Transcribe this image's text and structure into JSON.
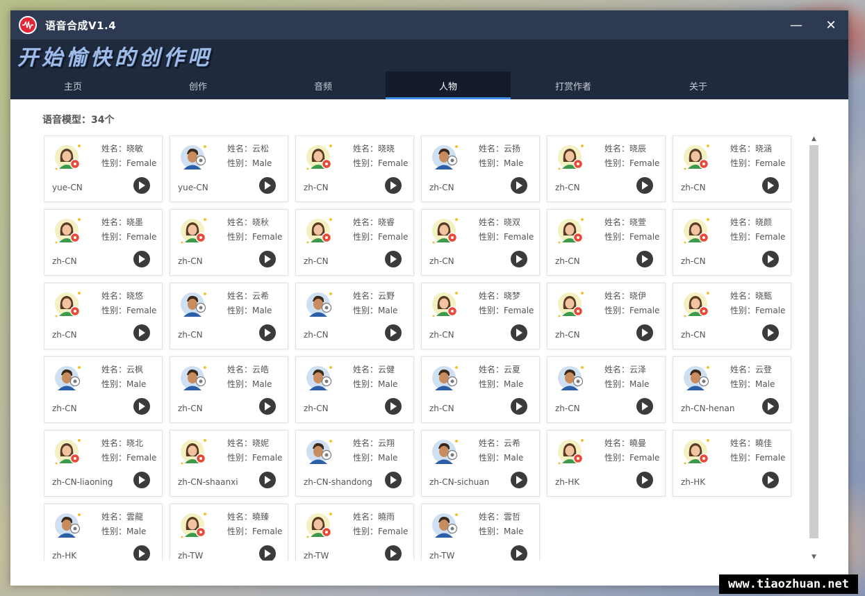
{
  "app": {
    "title": "语音合成V1.4",
    "banner": "开始愉快的创作吧"
  },
  "window_controls": {
    "minimize": "—",
    "close": "✕"
  },
  "tabs": [
    {
      "label": "主页"
    },
    {
      "label": "创作"
    },
    {
      "label": "音频"
    },
    {
      "label": "人物",
      "active": true
    },
    {
      "label": "打赏作者"
    },
    {
      "label": "关于"
    }
  ],
  "labels": {
    "name_prefix": "姓名：",
    "gender_prefix": "性别："
  },
  "model_count_text": "语音模型：34个",
  "voices": [
    {
      "name": "晓敏",
      "gender": "Female",
      "locale": "yue-CN"
    },
    {
      "name": "云松",
      "gender": "Male",
      "locale": "yue-CN"
    },
    {
      "name": "晓晓",
      "gender": "Female",
      "locale": "zh-CN"
    },
    {
      "name": "云扬",
      "gender": "Male",
      "locale": "zh-CN"
    },
    {
      "name": "晓辰",
      "gender": "Female",
      "locale": "zh-CN"
    },
    {
      "name": "晓涵",
      "gender": "Female",
      "locale": "zh-CN"
    },
    {
      "name": "晓墨",
      "gender": "Female",
      "locale": "zh-CN"
    },
    {
      "name": "晓秋",
      "gender": "Female",
      "locale": "zh-CN"
    },
    {
      "name": "晓睿",
      "gender": "Female",
      "locale": "zh-CN"
    },
    {
      "name": "晓双",
      "gender": "Female",
      "locale": "zh-CN"
    },
    {
      "name": "晓萱",
      "gender": "Female",
      "locale": "zh-CN"
    },
    {
      "name": "晓颜",
      "gender": "Female",
      "locale": "zh-CN"
    },
    {
      "name": "晓悠",
      "gender": "Female",
      "locale": "zh-CN"
    },
    {
      "name": "云希",
      "gender": "Male",
      "locale": "zh-CN"
    },
    {
      "name": "云野",
      "gender": "Male",
      "locale": "zh-CN"
    },
    {
      "name": "晓梦",
      "gender": "Female",
      "locale": "zh-CN"
    },
    {
      "name": "晓伊",
      "gender": "Female",
      "locale": "zh-CN"
    },
    {
      "name": "晓甄",
      "gender": "Female",
      "locale": "zh-CN"
    },
    {
      "name": "云枫",
      "gender": "Male",
      "locale": "zh-CN"
    },
    {
      "name": "云皓",
      "gender": "Male",
      "locale": "zh-CN"
    },
    {
      "name": "云健",
      "gender": "Male",
      "locale": "zh-CN"
    },
    {
      "name": "云夏",
      "gender": "Male",
      "locale": "zh-CN"
    },
    {
      "name": "云泽",
      "gender": "Male",
      "locale": "zh-CN"
    },
    {
      "name": "云登",
      "gender": "Male",
      "locale": "zh-CN-henan"
    },
    {
      "name": "晓北",
      "gender": "Female",
      "locale": "zh-CN-liaoning"
    },
    {
      "name": "晓妮",
      "gender": "Female",
      "locale": "zh-CN-shaanxi"
    },
    {
      "name": "云翔",
      "gender": "Male",
      "locale": "zh-CN-shandong"
    },
    {
      "name": "云希",
      "gender": "Male",
      "locale": "zh-CN-sichuan"
    },
    {
      "name": "曉曼",
      "gender": "Female",
      "locale": "zh-HK"
    },
    {
      "name": "曉佳",
      "gender": "Female",
      "locale": "zh-HK"
    },
    {
      "name": "雲龍",
      "gender": "Male",
      "locale": "zh-HK"
    },
    {
      "name": "曉臻",
      "gender": "Female",
      "locale": "zh-TW"
    },
    {
      "name": "曉雨",
      "gender": "Female",
      "locale": "zh-TW"
    },
    {
      "name": "雲哲",
      "gender": "Male",
      "locale": "zh-TW"
    }
  ],
  "icons": {
    "app": "sound-wave-icon",
    "female_avatar": "female-avatar-icon",
    "male_avatar": "male-avatar-icon",
    "play": "play-icon"
  },
  "colors": {
    "titlebar": "#2e3a52",
    "tabbar": "#1f2a3e",
    "active_tab": "#141c2c",
    "accent": "#3d8fe6",
    "play_button": "#3b3b3b"
  },
  "watermark": "www.tiaozhuan.net"
}
